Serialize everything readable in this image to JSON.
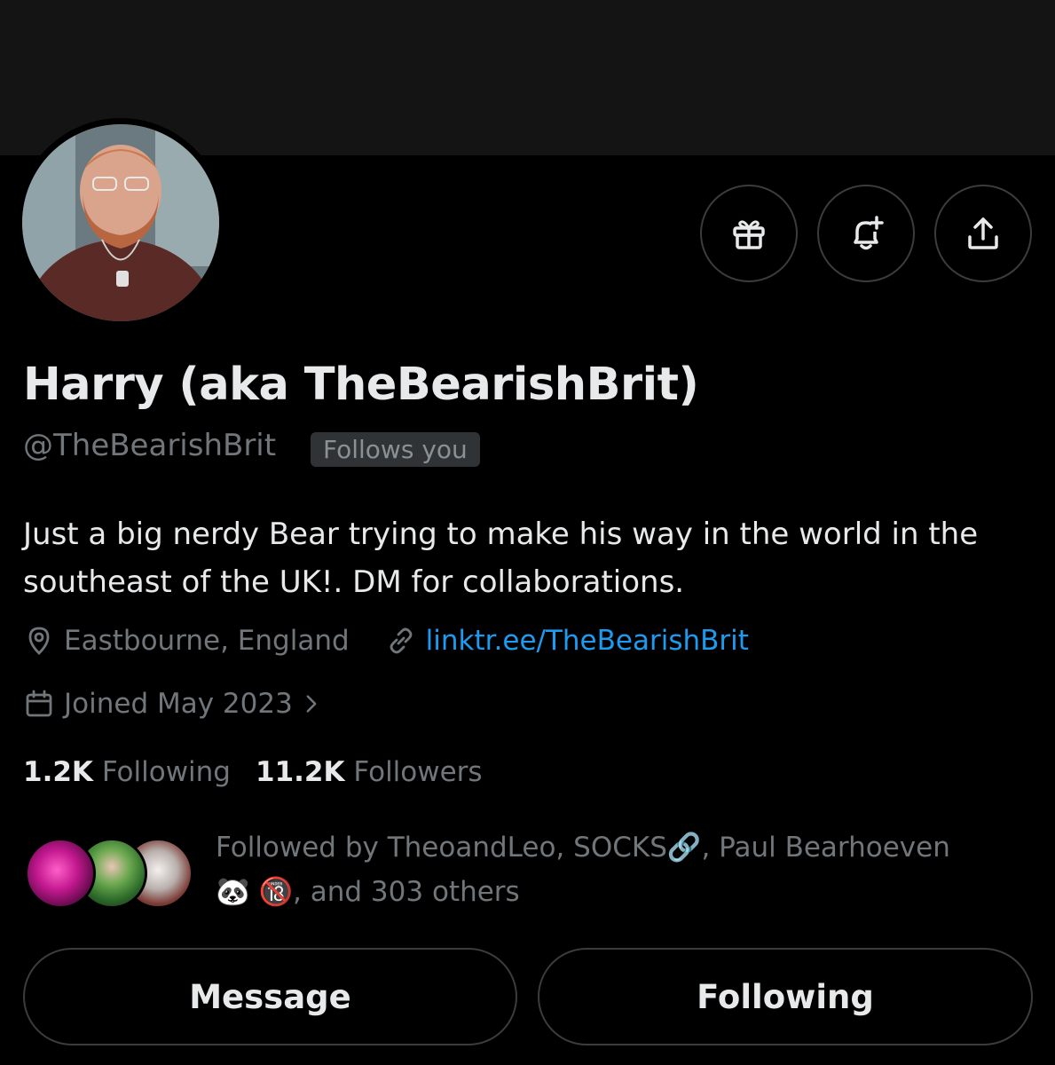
{
  "profile": {
    "display_name": "Harry (aka TheBearishBrit)",
    "handle": "@TheBearishBrit",
    "follows_you_badge": "Follows you",
    "bio": "Just a big nerdy Bear trying to make his way in the world in the southeast of the UK!. DM for collaborations.",
    "location": "Eastbourne, England",
    "website": "linktr.ee/TheBearishBrit",
    "joined": "Joined May 2023"
  },
  "actions": {
    "gift_icon": "gift-icon",
    "notify_icon": "bell-plus-icon",
    "share_icon": "share-icon"
  },
  "stats": {
    "following_count": "1.2K",
    "following_label": "Following",
    "followers_count": "11.2K",
    "followers_label": "Followers"
  },
  "followed_by": {
    "line1": "Followed by TheoandLeo, SOCKS🔗, Paul Bearhoeven",
    "line2": "🐼 🔞, and 303 others"
  },
  "buttons": {
    "message_label": "Message",
    "following_label": "Following"
  },
  "colors": {
    "background": "#000000",
    "banner": "#141414",
    "text_primary": "#e7e9ea",
    "text_secondary": "#71767b",
    "link": "#1d9bf0",
    "border": "#3a3d40",
    "badge_bg": "#2f3336"
  }
}
